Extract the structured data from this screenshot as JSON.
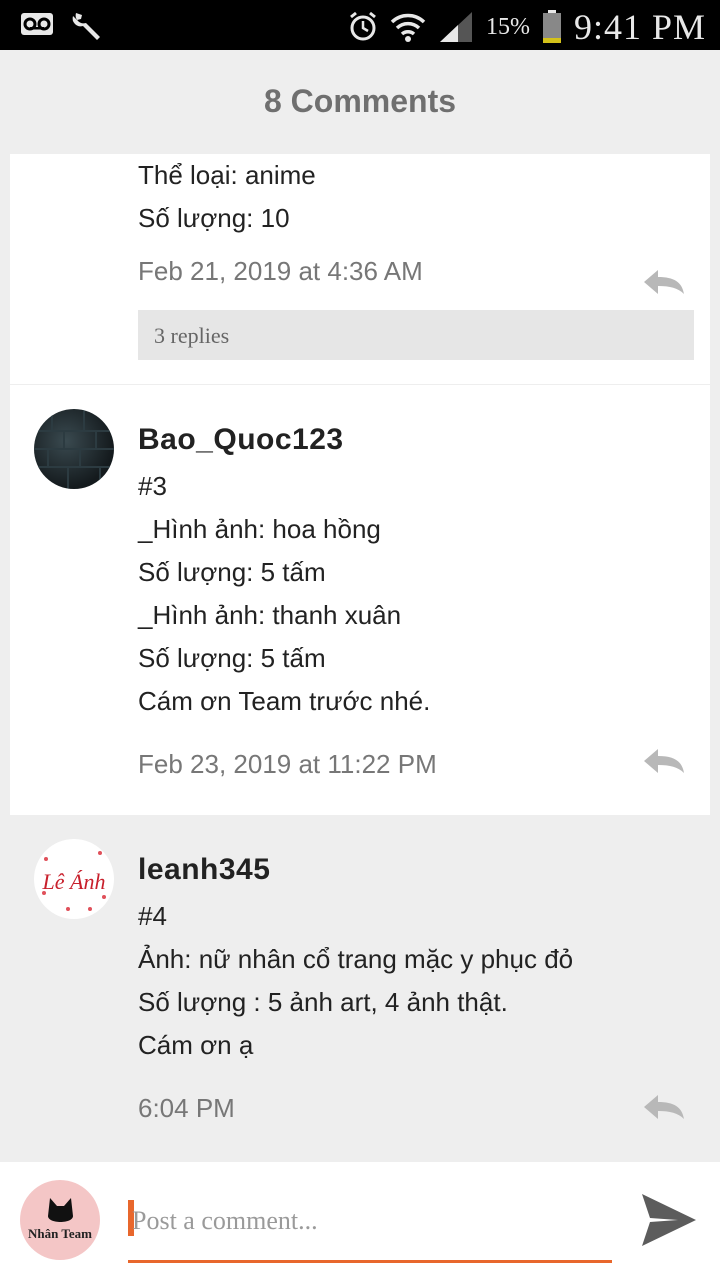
{
  "status_bar": {
    "battery_percent": "15%",
    "time": "9:41 PM",
    "icons": [
      "voicemail-icon",
      "wrench-icon",
      "alarm-icon",
      "wifi-icon",
      "signal-icon",
      "battery-icon"
    ]
  },
  "header": {
    "title": "8 Comments"
  },
  "comments": [
    {
      "lines": [
        "Thể loại: anime",
        "Số lượng: 10"
      ],
      "timestamp": "Feb 21, 2019 at 4:36 AM",
      "replies_label": "3 replies"
    },
    {
      "author": "Bao_Quoc123",
      "lines": [
        "#3",
        "_Hình ảnh: hoa hồng",
        "Số lượng: 5 tấm",
        "_Hình ảnh: thanh xuân",
        "Số lượng: 5 tấm",
        "Cám ơn Team trước nhé."
      ],
      "timestamp": "Feb 23, 2019 at 11:22 PM"
    },
    {
      "author": "leanh345",
      "avatar_text": "Lê Ánh",
      "lines": [
        "#4",
        "Ảnh: nữ nhân cổ trang mặc y phục đỏ",
        "Số lượng : 5 ảnh art, 4 ảnh thật.",
        "Cám ơn ạ"
      ],
      "timestamp": "6:04 PM"
    }
  ],
  "composer": {
    "placeholder": "Post a comment...",
    "avatar_text": "Nhân Team"
  },
  "colors": {
    "accent": "#e8672c",
    "background": "#eeeeee",
    "card": "#ffffff"
  }
}
